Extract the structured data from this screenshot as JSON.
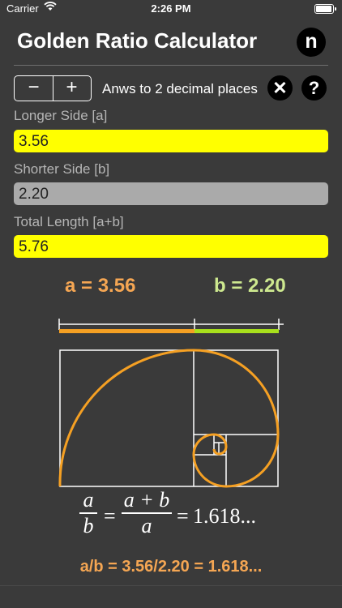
{
  "status": {
    "carrier": "Carrier",
    "time": "2:26 PM"
  },
  "header": {
    "title": "Golden Ratio Calculator",
    "n_label": "n"
  },
  "controls": {
    "minus": "−",
    "plus": "+",
    "precision_text": "Anws to 2 decimal places",
    "clear_symbol": "✕",
    "help_symbol": "?"
  },
  "fields": {
    "longer": {
      "label": "Longer Side [a]",
      "value": "3.56"
    },
    "shorter": {
      "label": "Shorter Side [b]",
      "value": "2.20"
    },
    "total": {
      "label": "Total Length [a+b]",
      "value": "5.76"
    }
  },
  "results": {
    "a_text": "a = 3.56",
    "b_text": "b = 2.20"
  },
  "formula": {
    "lhs_num": "a",
    "lhs_den": "b",
    "mid_num": "a + b",
    "mid_den": "a",
    "eq1": "=",
    "eq2": "=",
    "value": "1.618..."
  },
  "summary": "a/b = 3.56/2.20 = 1.618...",
  "colors": {
    "a": "#f5a023",
    "b": "#a8e01c",
    "field_highlight": "#ffff00",
    "field_computed": "#aaaaaa"
  }
}
